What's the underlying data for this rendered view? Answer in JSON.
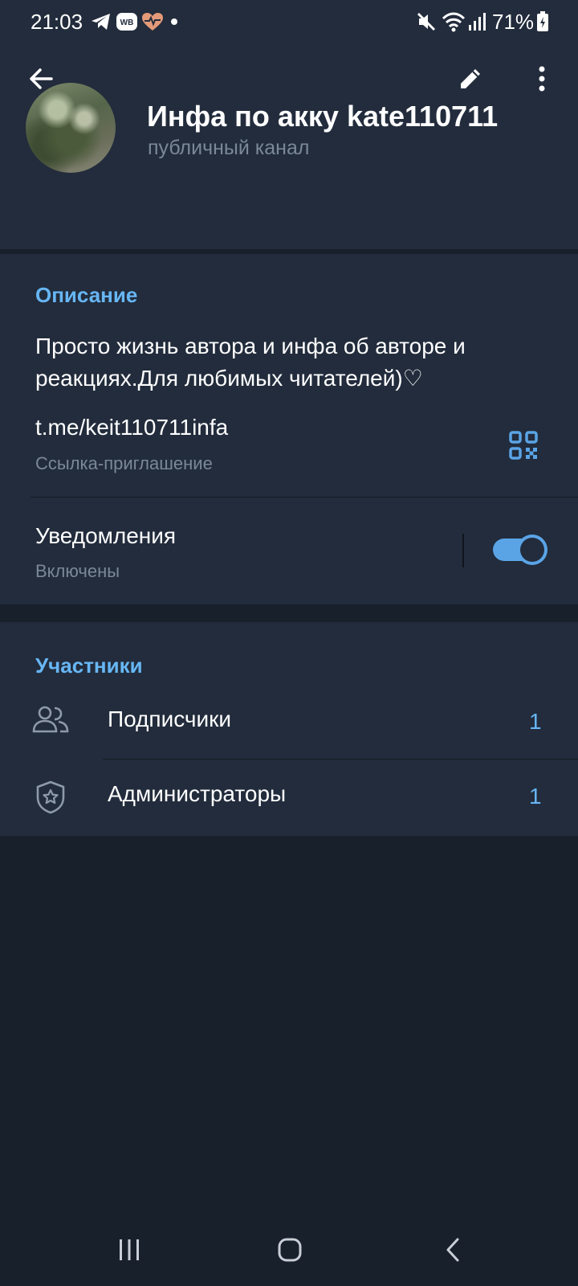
{
  "status_bar": {
    "time": "21:03",
    "battery": "71%",
    "icons": [
      "telegram-icon",
      "wb-icon",
      "health-icon",
      "dot-icon",
      "mute-icon",
      "wifi-icon",
      "signal-icon",
      "battery-icon"
    ]
  },
  "header": {
    "title": "Инфа по акку kate110711",
    "subtitle": "публичный канал",
    "icons": [
      "back-arrow-icon",
      "edit-pencil-icon",
      "more-vertical-icon"
    ]
  },
  "info": {
    "section_title": "Описание",
    "description": "Просто жизнь автора и инфа об авторе и реакциях.Для любимых читателей)♡",
    "link": "t.me/keit110711infa",
    "link_caption": "Ссылка-приглашение",
    "notifications_label": "Уведомления",
    "notifications_status": "Включены",
    "notifications_on": true
  },
  "members": {
    "section_title": "Участники",
    "rows": [
      {
        "label": "Подписчики",
        "count": "1",
        "icon": "people-icon"
      },
      {
        "label": "Администраторы",
        "count": "1",
        "icon": "shield-star-icon"
      }
    ]
  },
  "colors": {
    "accent": "#67b6f4",
    "toggle": "#5aa4e6",
    "card_bg": "#222c3c",
    "page_bg": "#18202c",
    "secondary_text": "#7b8896"
  }
}
